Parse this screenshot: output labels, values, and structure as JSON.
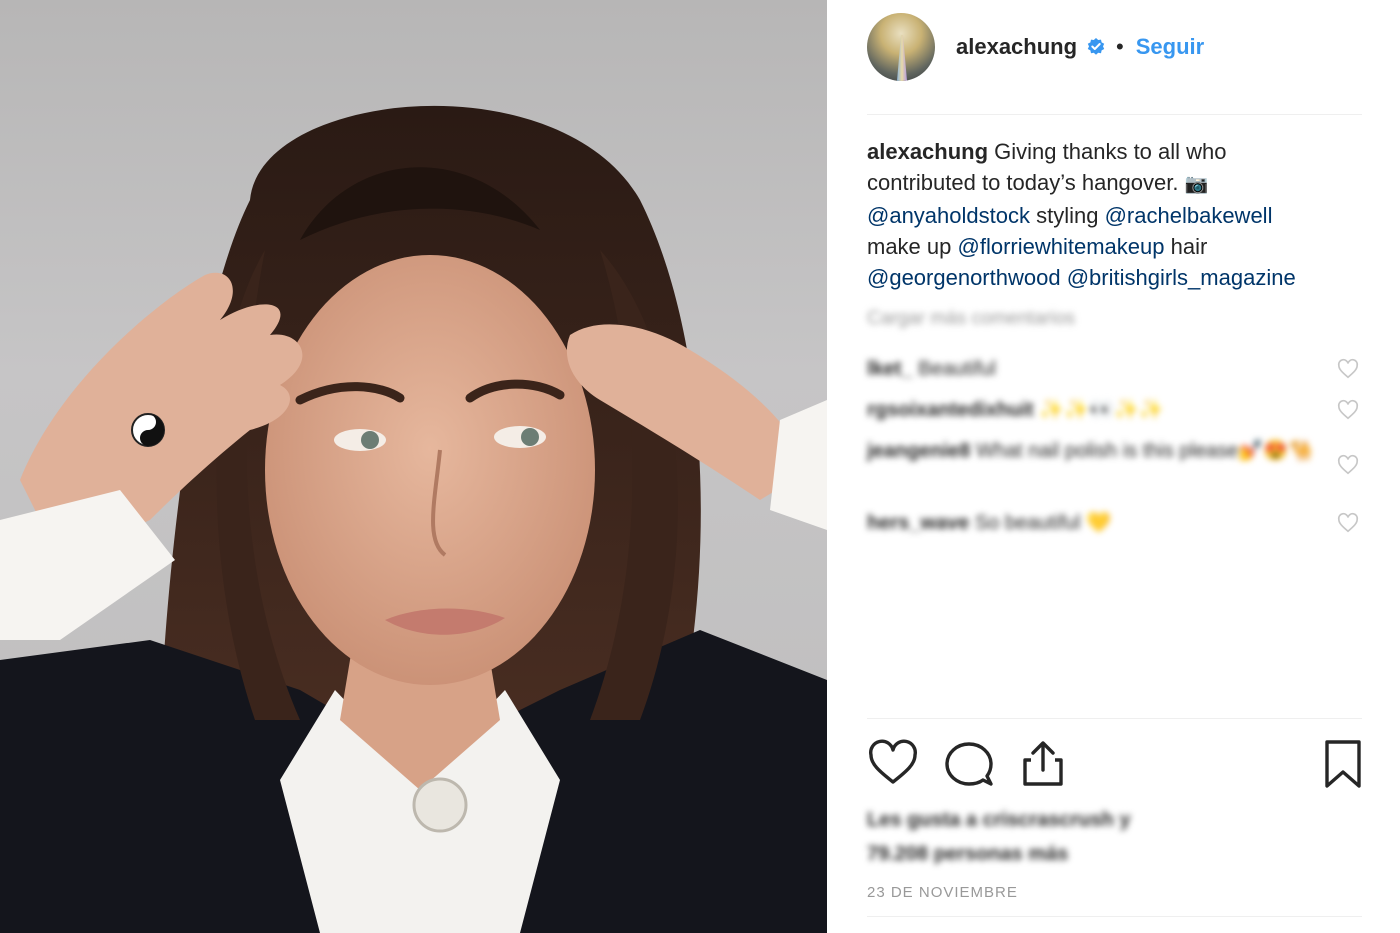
{
  "post": {
    "photo_alt": "",
    "user": {
      "handle": "alexachung",
      "verified": true,
      "follow_label": "Seguir",
      "separator": "•"
    },
    "caption": {
      "user": "alexachung",
      "line1_text": "Giving thanks to all who",
      "line2_text": "contributed to today’s hangover.",
      "camera_icon": "📷",
      "mention1": "@anyaholdstock",
      "word_styling": "styling",
      "mention2": "@rachelbakewell",
      "word_makeup": "make up",
      "mention3": "@florriewhitemakeup",
      "word_hair": "hair",
      "mention4": "@georgenorthwood",
      "mention5": "@britishgirls_magazine"
    },
    "load_more_label": "Cargar más comentarios",
    "comments": [
      {
        "user": "lket_",
        "text": "Beautiful"
      },
      {
        "user": "rgsoixantedixhuit",
        "text": "✨✨👀✨✨"
      },
      {
        "user": "jeangenie8",
        "text": "What nail polish is this please💅😍🐪"
      },
      {
        "user": "hers_wave",
        "text": "So beautiful 💛"
      }
    ],
    "likes_line1": "Les gusta a criscrascrush y",
    "likes_line2": "79.208 personas más",
    "date": "23 DE NOVIEMBRE"
  },
  "colors": {
    "accent_blue": "#3897f0",
    "mention_blue": "#003569",
    "text": "#262626",
    "muted": "#999999"
  },
  "icons": [
    "verified-badge-icon",
    "heart-icon",
    "comment-icon",
    "share-icon",
    "bookmark-icon"
  ]
}
